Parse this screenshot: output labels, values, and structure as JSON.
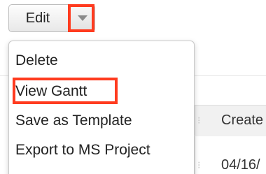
{
  "action_button": {
    "label": "Edit",
    "caret_icon": "chevron-down-icon",
    "highlight_color": "#ff3b1f"
  },
  "menu": {
    "items": [
      {
        "label": "Delete"
      },
      {
        "label": "View Gantt",
        "highlighted": true
      },
      {
        "label": "Save as Template"
      },
      {
        "label": "Export to MS Project"
      }
    ]
  },
  "background_table": {
    "header_text": "Create",
    "row_text": "04/16/"
  }
}
